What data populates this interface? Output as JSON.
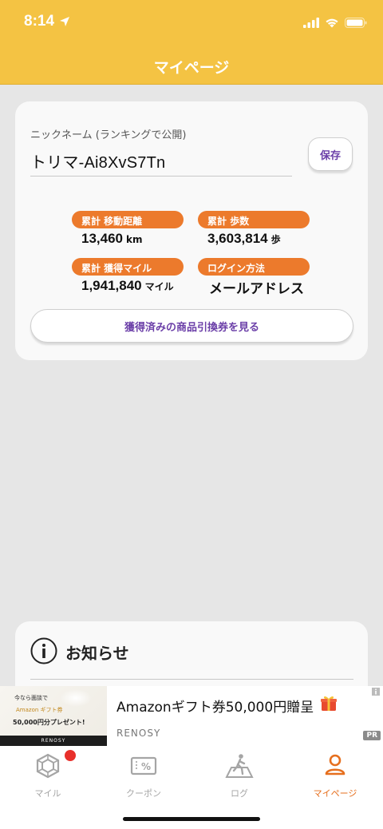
{
  "status_bar": {
    "time": "8:14"
  },
  "nav": {
    "title": "マイページ"
  },
  "profile": {
    "nickname_label": "ニックネーム (ランキングで公開)",
    "nickname_value": "トリマ-Ai8XvS7Tn",
    "save_label": "保存",
    "stats": [
      {
        "label": "累計 移動距離",
        "value": "13,460",
        "unit": "km"
      },
      {
        "label": "累計 歩数",
        "value": "3,603,814",
        "unit": "歩"
      },
      {
        "label": "累計 獲得マイル",
        "value": "1,941,840",
        "unit": "マイル"
      },
      {
        "label": "ログイン方法",
        "value": "メールアドレス",
        "unit": ""
      }
    ],
    "coupons_button_label": "獲得済みの商品引換券を見る"
  },
  "news": {
    "title": "お知らせ"
  },
  "ad": {
    "thumb_line1": "今なら面談で",
    "thumb_line2": "Amazon ギフト券",
    "thumb_line3": "50,000円分プレゼント!",
    "thumb_brand": "RENOSY",
    "title": "Amazonギフト券50,000円贈呈",
    "sponsor": "RENOSY",
    "pr_label": "PR"
  },
  "tabs": [
    {
      "label": "マイル",
      "icon": "hexagon-gem-icon"
    },
    {
      "label": "クーポン",
      "icon": "coupon-icon"
    },
    {
      "label": "ログ",
      "icon": "walking-person-icon"
    },
    {
      "label": "マイページ",
      "icon": "person-icon"
    }
  ],
  "colors": {
    "header": "#f4c343",
    "accent_orange": "#ec7a2c",
    "button_text_purple": "#6b3fa8",
    "tab_active": "#e66f1e",
    "tab_inactive": "#a5a5a5",
    "badge_red": "#e8302b"
  }
}
